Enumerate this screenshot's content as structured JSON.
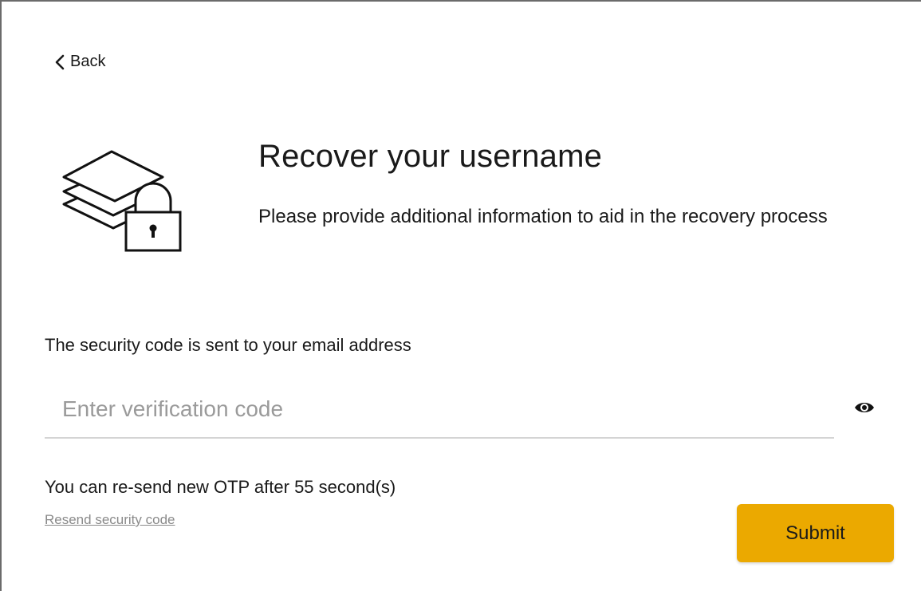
{
  "nav": {
    "back_label": "Back",
    "back_icon": "chevron-left-icon"
  },
  "header": {
    "icon": "layers-lock-icon",
    "title": "Recover your username",
    "subtitle": "Please provide additional information to aid in the recovery process"
  },
  "form": {
    "info_text": "The security code is sent to your email address",
    "code_placeholder": "Enter verification code",
    "code_value": "",
    "visibility_icon": "eye-icon",
    "otp_text": "You can re-send new OTP after 55 second(s)",
    "resend_label": "Resend security code",
    "submit_label": "Submit"
  },
  "colors": {
    "accent": "#eba900",
    "input_underline": "#d4d4d4",
    "placeholder": "#9a9a9a",
    "link_muted": "#8a8a8a"
  }
}
